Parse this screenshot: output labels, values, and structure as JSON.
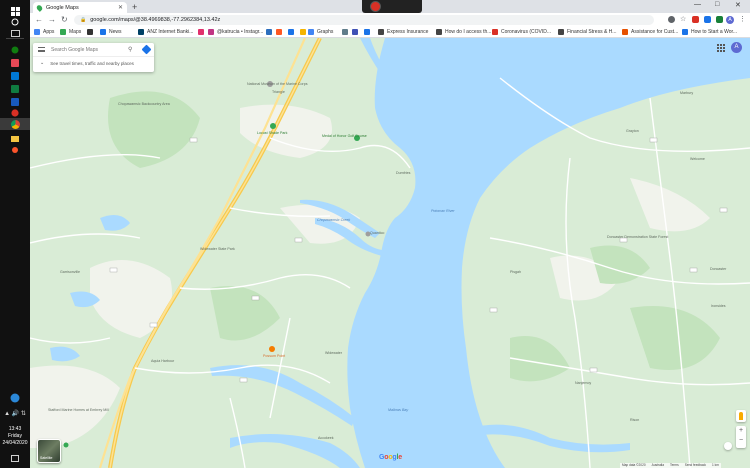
{
  "taskbar": {
    "time": "13:43",
    "day": "Friday",
    "date": "24/04/2020"
  },
  "browser": {
    "tab_title": "Google Maps",
    "url": "google.com/maps/@38.4969838,-77.2962384,13.42z",
    "bookmarks": [
      {
        "label": "Apps",
        "color": "#4285f4"
      },
      {
        "label": "Maps",
        "color": "#34a853"
      },
      {
        "label": "",
        "color": "#333333"
      },
      {
        "label": "News",
        "color": "#1a73e8"
      },
      {
        "label": "ANZ Internet Banki...",
        "color": "#004165"
      },
      {
        "label": "",
        "color": "#e1306c"
      },
      {
        "label": "@katrucia • Instagr...",
        "color": "#c13584"
      },
      {
        "label": "",
        "color": "#2c6ebe"
      },
      {
        "label": "",
        "color": "#ff5722"
      },
      {
        "label": "",
        "color": "#1a73e8"
      },
      {
        "label": "",
        "color": "#f4b400"
      },
      {
        "label": "Graphs",
        "color": "#4285f4"
      },
      {
        "label": "",
        "color": "#607d8b"
      },
      {
        "label": "",
        "color": "#3f51b5"
      },
      {
        "label": "",
        "color": "#1a73e8"
      },
      {
        "label": "Express Insurance",
        "color": "#444444"
      },
      {
        "label": "How do I access th...",
        "color": "#444444"
      },
      {
        "label": "Coronavirus (COVID...",
        "color": "#d93025"
      },
      {
        "label": "Financial Stress & H...",
        "color": "#444444"
      },
      {
        "label": "Assistance for Cust...",
        "color": "#e65100"
      },
      {
        "label": "How to Start a Wor...",
        "color": "#1a73e8"
      }
    ]
  },
  "search": {
    "placeholder": "Search Google Maps",
    "subtitle": "See travel times, traffic and nearby places"
  },
  "map": {
    "labels": {
      "dumfries": "Dumfries",
      "pwfa": "Prince William Forest Park",
      "quantico": "Quantico",
      "liberty": "Liberty Park",
      "chopawamsic": "Chopawamsic Backcountry Area",
      "nmmc": "National Museum of the Marine Corps",
      "triangle": "Triangle",
      "locust": "Locust Shade Park",
      "medal": "Medal of Honor Golf Course",
      "widewater": "Widewater",
      "aquia": "Aquia Harbour",
      "stafford_marine": "Stafford Marine Homes at Embrey Mill",
      "accokeek": "Accokeek",
      "garrisonville": "Garrisonville",
      "possum": "Possum Point",
      "nanjemoy": "Nanjemoy",
      "doncaster": "Doncaster Demonstration State Forest",
      "potomac": "Potomac River",
      "mallows": "Mallows Bay",
      "quantico_town": "Quantico",
      "marine_bay": "Chopawamsic Creek",
      "widewater_park": "Widewater State Park",
      "caledon": "Caledon",
      "mason": "Mason Neck",
      "rosaryville": "Rison",
      "park_hall": "Pisgah",
      "nanjemoy_creek": "Nanjemoy Creek",
      "grayton": "Grayton",
      "marbury": "Marbury",
      "doncaster_town": "Doncaster",
      "ironsides": "Ironsides",
      "welcome": "Welcome",
      "marshall_hall": "Riverside"
    },
    "logo": "Google",
    "footer": [
      "Map data ©2020",
      "Australia",
      "Terms",
      "Send feedback",
      "1 km"
    ],
    "layer_label": "Satellite",
    "avatar_letter": "A"
  }
}
